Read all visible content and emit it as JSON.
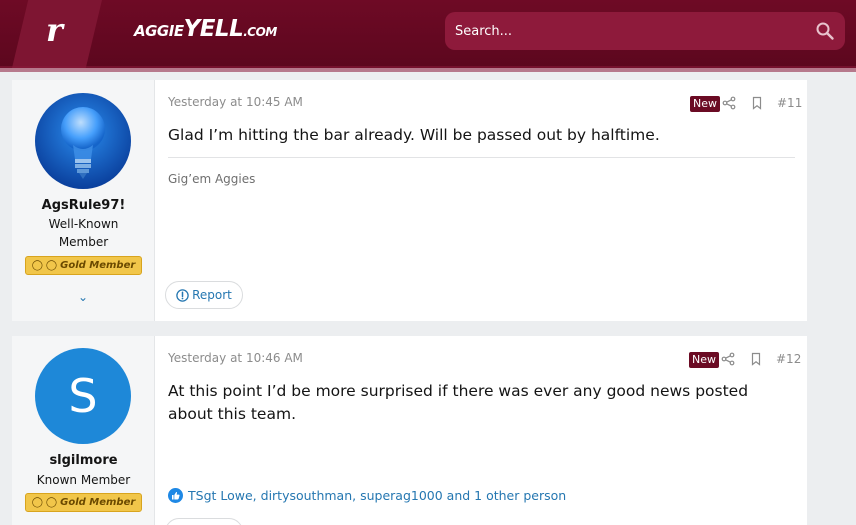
{
  "header": {
    "logo_letter": "r",
    "site_name": {
      "part1": "AGGIE",
      "part2": "YELL",
      "part3": ".COM"
    },
    "search": {
      "placeholder": "Search..."
    },
    "colors": {
      "brand": "#5c071e",
      "search_bg": "#8e1a3a"
    }
  },
  "posts": [
    {
      "user": {
        "name": "AgsRule97!",
        "title": "Well-Known Member",
        "badge": "Gold Member",
        "avatar": "lightbulb-avatar"
      },
      "date": "Yesterday at 10:45 AM",
      "new_label": "New",
      "number": "#11",
      "message": "Glad I’m hitting the bar already. Will be passed out by halftime.",
      "signature": "Gig’em Aggies",
      "report_label": "Report"
    },
    {
      "user": {
        "name": "slgilmore",
        "title": "Known Member",
        "badge": "Gold Member",
        "avatar_letter": "S"
      },
      "date": "Yesterday at 10:46 AM",
      "new_label": "New",
      "number": "#12",
      "message": "At this point I’d be more surprised if there was ever any good news posted about this team.",
      "reactions": "TSgt Lowe, dirtysouthman, superag1000 and 1 other person"
    }
  ]
}
